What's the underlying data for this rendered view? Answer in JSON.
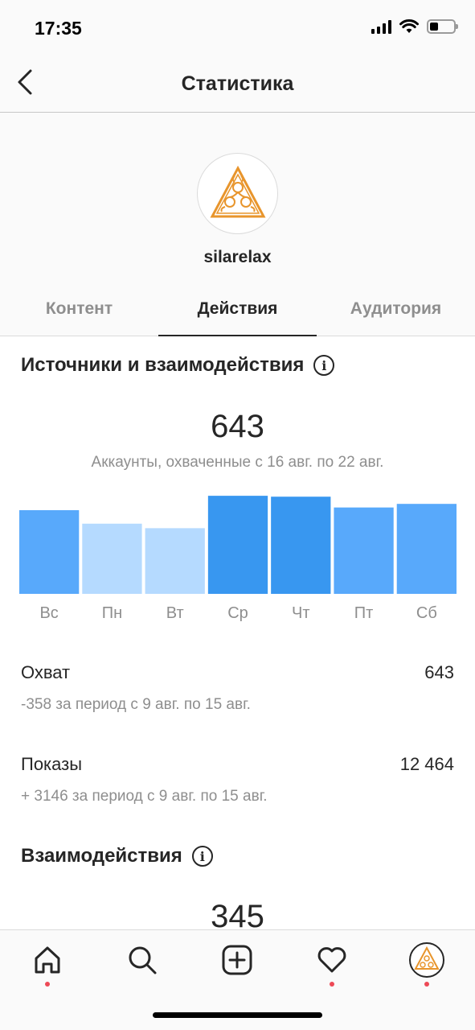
{
  "status_bar": {
    "time": "17:35",
    "battery_level": 0.35
  },
  "header": {
    "title": "Статистика",
    "back_icon": "chevron-left-icon"
  },
  "profile": {
    "username": "silarelax",
    "avatar_icon": "triangle-leaf-logo"
  },
  "tabs": [
    {
      "label": "Контент",
      "active": false
    },
    {
      "label": "Действия",
      "active": true
    },
    {
      "label": "Аудитория",
      "active": false
    }
  ],
  "sources": {
    "title": "Источники и взаимодействия",
    "total": "643",
    "caption": "Аккаунты, охваченные с 16 авг. по 22 авг."
  },
  "chart_data": {
    "type": "bar",
    "categories": [
      "Вс",
      "Пн",
      "Вт",
      "Ср",
      "Чт",
      "Пт",
      "Сб"
    ],
    "values": [
      93,
      78,
      73,
      109,
      108,
      96,
      100
    ],
    "colors": [
      "#58a9fb",
      "#b5daff",
      "#b5daff",
      "#3897f0",
      "#3897f0",
      "#58a9fb",
      "#58a9fb"
    ],
    "ylim": [
      0,
      110
    ],
    "grid": false
  },
  "metrics": [
    {
      "label": "Охват",
      "value": "643",
      "change": "-358 за период с 9 авг. по 15 авг."
    },
    {
      "label": "Показы",
      "value": "12 464",
      "change": "+ 3146 за период с 9 авг. по 15 авг."
    }
  ],
  "interactions": {
    "title": "Взаимодействия",
    "total": "345"
  },
  "bottom_nav": [
    {
      "name": "home-icon",
      "has_dot": true
    },
    {
      "name": "search-icon",
      "has_dot": false
    },
    {
      "name": "add-post-icon",
      "has_dot": false
    },
    {
      "name": "heart-icon",
      "has_dot": true
    },
    {
      "name": "profile-avatar-icon",
      "has_dot": true
    }
  ],
  "colors": {
    "accent": "#3897f0",
    "notification_dot": "#ed4956",
    "logo_orange": "#e8952c"
  }
}
